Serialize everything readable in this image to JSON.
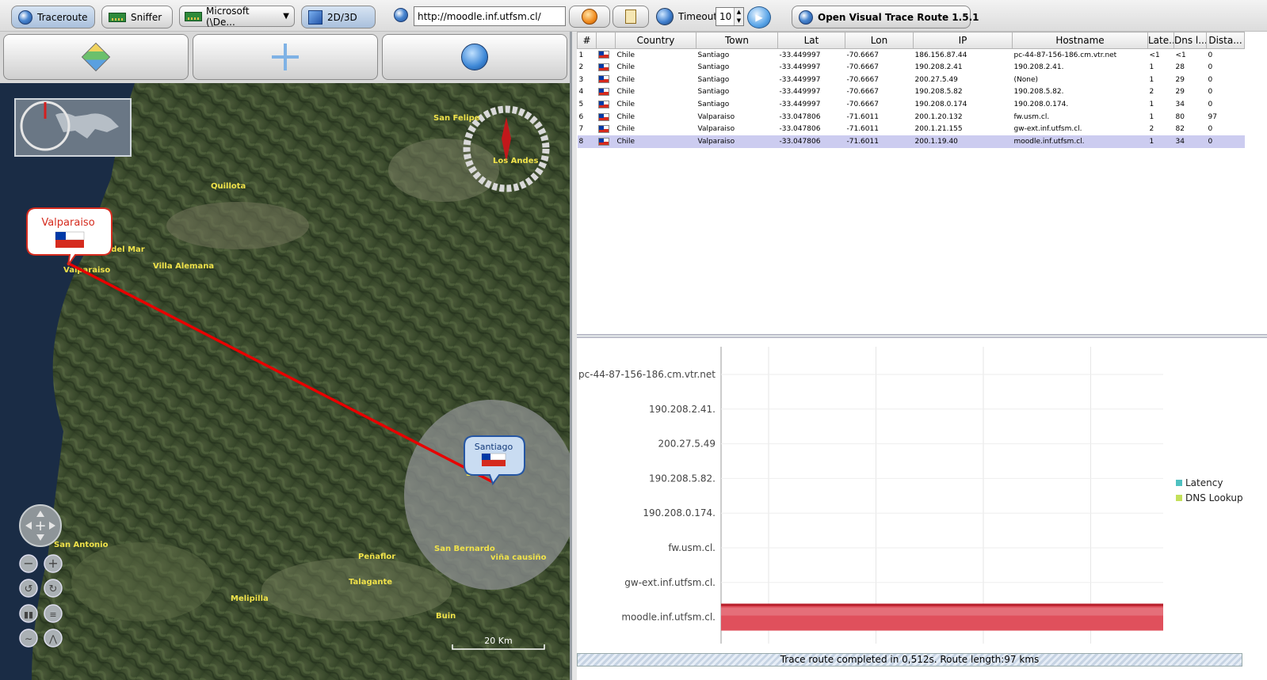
{
  "toolbar": {
    "traceroute_label": "Traceroute",
    "sniffer_label": "Sniffer",
    "interface_value": "Microsoft (\\De...",
    "view_toggle_label": "2D/3D",
    "url_value": "http://moodle.inf.utfsm.cl/",
    "timeout_label": "Timeout",
    "timeout_value": "10",
    "app_title": "Open Visual Trace Route 1.5.1"
  },
  "map": {
    "places": [
      {
        "name": "San Felipe"
      },
      {
        "name": "Los Andes"
      },
      {
        "name": "Quillota"
      },
      {
        "name": "Viña del Mar",
        "display": "a del Mar"
      },
      {
        "name": "Villa Alemana"
      },
      {
        "name": "Valparaiso"
      },
      {
        "name": "Santiago"
      },
      {
        "name": "San Antonio"
      },
      {
        "name": "San Bernardo"
      },
      {
        "name": "Peñaflor"
      },
      {
        "name": "viña causiño"
      },
      {
        "name": "Talagante"
      },
      {
        "name": "Melipilla"
      },
      {
        "name": "Buin"
      }
    ],
    "callouts": {
      "origin": "Valparaiso",
      "destination": "Santiago"
    },
    "scale_label": "20 Km",
    "route_color": "#e80000"
  },
  "table": {
    "columns": [
      "#",
      "",
      "Country",
      "Town",
      "Lat",
      "Lon",
      "IP",
      "Hostname",
      "Late...",
      "Dns l...",
      "Dista..."
    ],
    "rows": [
      {
        "n": "1",
        "country": "Chile",
        "town": "Santiago",
        "lat": "-33.449997",
        "lon": "-70.6667",
        "ip": "186.156.87.44",
        "host": "pc-44-87-156-186.cm.vtr.net",
        "latency": "<1",
        "dns": "<1",
        "dist": "0"
      },
      {
        "n": "2",
        "country": "Chile",
        "town": "Santiago",
        "lat": "-33.449997",
        "lon": "-70.6667",
        "ip": "190.208.2.41",
        "host": "190.208.2.41.",
        "latency": "1",
        "dns": "28",
        "dist": "0"
      },
      {
        "n": "3",
        "country": "Chile",
        "town": "Santiago",
        "lat": "-33.449997",
        "lon": "-70.6667",
        "ip": "200.27.5.49",
        "host": "(None)",
        "latency": "1",
        "dns": "29",
        "dist": "0"
      },
      {
        "n": "4",
        "country": "Chile",
        "town": "Santiago",
        "lat": "-33.449997",
        "lon": "-70.6667",
        "ip": "190.208.5.82",
        "host": "190.208.5.82.",
        "latency": "2",
        "dns": "29",
        "dist": "0"
      },
      {
        "n": "5",
        "country": "Chile",
        "town": "Santiago",
        "lat": "-33.449997",
        "lon": "-70.6667",
        "ip": "190.208.0.174",
        "host": "190.208.0.174.",
        "latency": "1",
        "dns": "34",
        "dist": "0"
      },
      {
        "n": "6",
        "country": "Chile",
        "town": "Valparaiso",
        "lat": "-33.047806",
        "lon": "-71.6011",
        "ip": "200.1.20.132",
        "host": "fw.usm.cl.",
        "latency": "1",
        "dns": "80",
        "dist": "97"
      },
      {
        "n": "7",
        "country": "Chile",
        "town": "Valparaiso",
        "lat": "-33.047806",
        "lon": "-71.6011",
        "ip": "200.1.21.155",
        "host": "gw-ext.inf.utfsm.cl.",
        "latency": "2",
        "dns": "82",
        "dist": "0"
      },
      {
        "n": "8",
        "country": "Chile",
        "town": "Valparaiso",
        "lat": "-33.047806",
        "lon": "-71.6011",
        "ip": "200.1.19.40",
        "host": "moodle.inf.utfsm.cl.",
        "latency": "1",
        "dns": "34",
        "dist": "0"
      }
    ],
    "selected_row": 8
  },
  "chart_data": {
    "type": "bar",
    "orientation": "horizontal",
    "stacked": true,
    "categories": [
      "pc-44-87-156-186.cm.vtr.net",
      "190.208.2.41.",
      "200.27.5.49",
      "190.208.5.82.",
      "190.208.0.174.",
      "fw.usm.cl.",
      "gw-ext.inf.utfsm.cl.",
      "moodle.inf.utfsm.cl."
    ],
    "series": [
      {
        "name": "Latency",
        "color": "#4fc1c1",
        "values": [
          0,
          0,
          0,
          0,
          0,
          0,
          0,
          0
        ]
      },
      {
        "name": "DNS Lookup",
        "color": "#c3e05a",
        "values": [
          0,
          0,
          0,
          0,
          0,
          0,
          0,
          0
        ]
      },
      {
        "color": "#e0505c",
        "values": [
          0,
          0,
          0,
          0,
          0,
          0,
          0,
          1
        ]
      }
    ],
    "highlight_color": "#e0505c",
    "legend_position": "right",
    "grid": true
  },
  "status": {
    "text": "Trace route completed in 0,512s. Route length:97 kms"
  }
}
